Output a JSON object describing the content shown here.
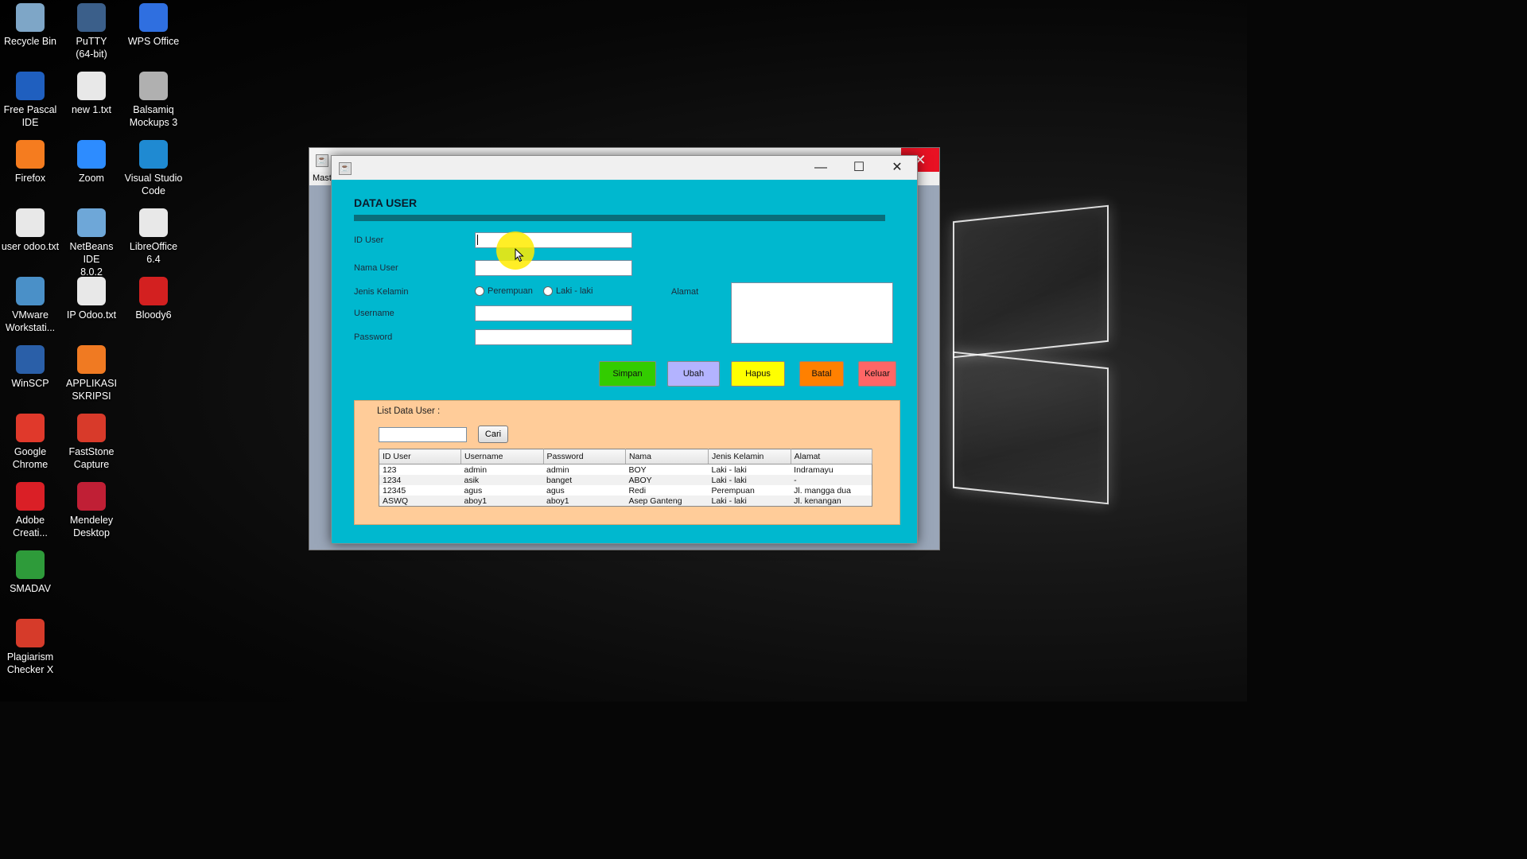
{
  "desktop": {
    "icons": [
      {
        "label": "Recycle Bin",
        "icon": "recycle-bin-icon",
        "color": "#7ea6c7"
      },
      {
        "label": "PuTTY\n(64-bit)",
        "icon": "putty-icon",
        "color": "#3b5f8a"
      },
      {
        "label": "WPS Office",
        "icon": "wps-icon",
        "color": "#2f6fe0"
      },
      {
        "label": "Free Pascal\nIDE",
        "icon": "free-pascal-icon",
        "color": "#1f5fbf"
      },
      {
        "label": "new 1.txt",
        "icon": "text-file-icon",
        "color": "#e8e8e8"
      },
      {
        "label": "Balsamiq\nMockups 3",
        "icon": "balsamiq-icon",
        "color": "#b0b0b0"
      },
      {
        "label": "Firefox",
        "icon": "firefox-icon",
        "color": "#f57c1f"
      },
      {
        "label": "Zoom",
        "icon": "zoom-icon",
        "color": "#2d8cff"
      },
      {
        "label": "Visual Studio\nCode",
        "icon": "vscode-icon",
        "color": "#1f8ad2"
      },
      {
        "label": "user odoo.txt",
        "icon": "text-file-icon",
        "color": "#e8e8e8"
      },
      {
        "label": "NetBeans IDE\n8.0.2",
        "icon": "netbeans-icon",
        "color": "#6ea7d8"
      },
      {
        "label": "LibreOffice\n6.4",
        "icon": "libreoffice-icon",
        "color": "#e8e8e8"
      },
      {
        "label": "VMware\nWorkstati...",
        "icon": "vmware-icon",
        "color": "#4a90c8"
      },
      {
        "label": "IP Odoo.txt",
        "icon": "text-file-icon",
        "color": "#e8e8e8"
      },
      {
        "label": "Bloody6",
        "icon": "bloody-icon",
        "color": "#d32020"
      },
      {
        "label": "WinSCP",
        "icon": "winscp-icon",
        "color": "#2a5fa8"
      },
      {
        "label": "APPLIKASI\nSKRIPSI",
        "icon": "xampp-icon",
        "color": "#f07a22"
      },
      {
        "label": "Google\nChrome",
        "icon": "chrome-icon",
        "color": "#e0392b"
      },
      {
        "label": "FastStone\nCapture",
        "icon": "faststone-icon",
        "color": "#d83a2a"
      },
      {
        "label": "Adobe\nCreati...",
        "icon": "adobe-cc-icon",
        "color": "#da1f26"
      },
      {
        "label": "Mendeley\nDesktop",
        "icon": "mendeley-icon",
        "color": "#c01f35"
      },
      {
        "label": "SMADAV",
        "icon": "smadav-icon",
        "color": "#2e9b3a"
      },
      {
        "label": "Plagiarism\nChecker X",
        "icon": "plagiarism-checker-icon",
        "color": "#d63b2a"
      }
    ]
  },
  "back_window": {
    "menu_text": "Mast",
    "close_glyph": "✕"
  },
  "front_window": {
    "title": "",
    "minimize_glyph": "—",
    "maximize_glyph": "☐",
    "close_glyph": "✕",
    "heading": "DATA USER",
    "form": {
      "id_user_label": "ID User",
      "id_user_value": "",
      "nama_user_label": "Nama User",
      "nama_user_value": "",
      "jenis_kelamin_label": "Jenis Kelamin",
      "radio_perempuan": "Perempuan",
      "radio_laki": "Laki - laki",
      "alamat_label": "Alamat",
      "alamat_value": "",
      "username_label": "Username",
      "username_value": "",
      "password_label": "Password",
      "password_value": ""
    },
    "buttons": {
      "simpan": "Simpan",
      "ubah": "Ubah",
      "hapus": "Hapus",
      "batal": "Batal",
      "keluar": "Keluar"
    },
    "button_colors": {
      "simpan": "#33cc00",
      "ubah": "#b3b3ff",
      "hapus": "#ffff00",
      "batal": "#ff8000",
      "keluar": "#ff6666"
    },
    "list": {
      "title": "List Data User :",
      "search_value": "",
      "search_button": "Cari",
      "columns": [
        "ID User",
        "Username",
        "Password",
        "Nama",
        "Jenis Kelamin",
        "Alamat"
      ],
      "rows": [
        [
          "123",
          "admin",
          "admin",
          "BOY",
          "Laki - laki",
          "Indramayu"
        ],
        [
          "1234",
          "asik",
          "banget",
          "ABOY",
          "Laki - laki",
          "-"
        ],
        [
          "12345",
          "agus",
          "agus",
          "Redi",
          "Perempuan",
          "Jl. mangga dua"
        ],
        [
          "ASWQ",
          "aboy1",
          "aboy1",
          "Asep Ganteng",
          "Laki - laki",
          "Jl. kenangan"
        ]
      ]
    }
  }
}
